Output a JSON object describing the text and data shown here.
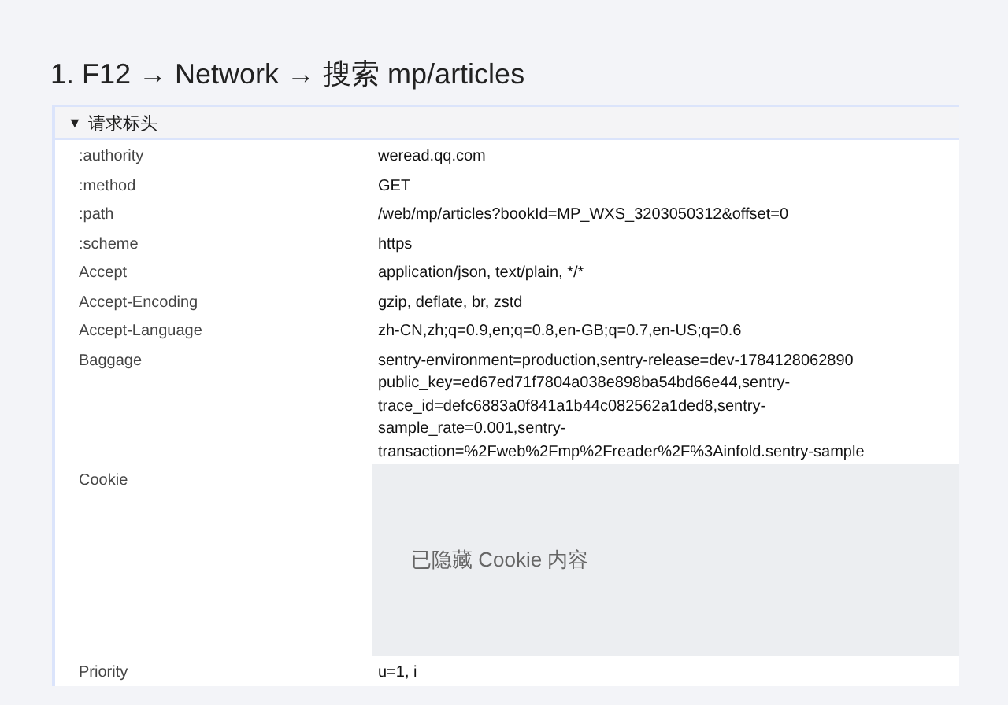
{
  "heading": "1. F12 → Network → 搜索 mp/articles",
  "panel": {
    "toggle": "▼",
    "title": "请求标头",
    "expanded": true,
    "rows": [
      {
        "kind": "text",
        "name": ":authority",
        "value": [
          "weread.qq.com"
        ]
      },
      {
        "kind": "text",
        "name": ":method",
        "value": [
          "GET"
        ]
      },
      {
        "kind": "text",
        "name": ":path",
        "value": [
          "/web/mp/articles?bookId=MP_WXS_3203050312&offset=0"
        ]
      },
      {
        "kind": "text",
        "name": ":scheme",
        "value": [
          "https"
        ]
      },
      {
        "kind": "text",
        "name": "Accept",
        "value": [
          "application/json, text/plain, */*"
        ]
      },
      {
        "kind": "text",
        "name": "Accept-Encoding",
        "value": [
          "gzip, deflate, br, zstd"
        ]
      },
      {
        "kind": "text",
        "name": "Accept-Language",
        "value": [
          "zh-CN,zh;q=0.9,en;q=0.8,en-GB;q=0.7,en-US;q=0.6"
        ]
      },
      {
        "kind": "text",
        "name": "Baggage",
        "value": [
          "sentry-environment=production,sentry-release=dev-1784128062890",
          "public_key=ed67ed71f7804a038e898ba54bd66e44,sentry-",
          "trace_id=defc6883a0f841a1b44c082562a1ded8,sentry-",
          "sample_rate=0.001,sentry-",
          "transaction=%2Fweb%2Fmp%2Freader%2F%3Ainfold.sentry-sample"
        ]
      },
      {
        "kind": "hidden",
        "name": "Cookie",
        "note": "已隐藏 Cookie 内容"
      },
      {
        "kind": "text",
        "name": "Priority",
        "value": [
          "u=1, i"
        ]
      }
    ]
  }
}
